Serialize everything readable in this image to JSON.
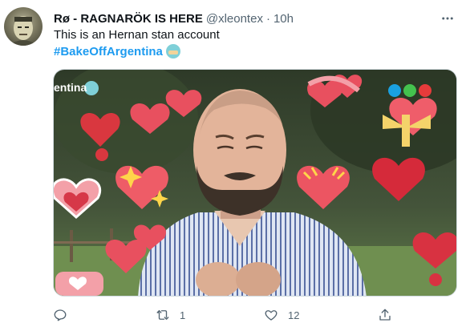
{
  "tweet": {
    "display_name": "Rø - RAGNARÖK IS HERE",
    "handle": "@xleontex",
    "separator": "·",
    "timestamp": "10h",
    "text": "This is an Hernan stan account",
    "hashtag": "#BakeOffArgentina",
    "media": {
      "brand_text": "entina",
      "alt": "Man smiling with hands on chest surrounded by heart stickers"
    }
  },
  "actions": {
    "reply_count": "",
    "retweet_count": "1",
    "like_count": "12"
  },
  "colors": {
    "accent": "#1d9bf0",
    "secondary_text": "#536471",
    "heart": "#e8505f"
  },
  "icons": [
    "avatar",
    "more-icon",
    "reply-icon",
    "retweet-icon",
    "like-icon",
    "share-icon",
    "hashflag-icon"
  ]
}
